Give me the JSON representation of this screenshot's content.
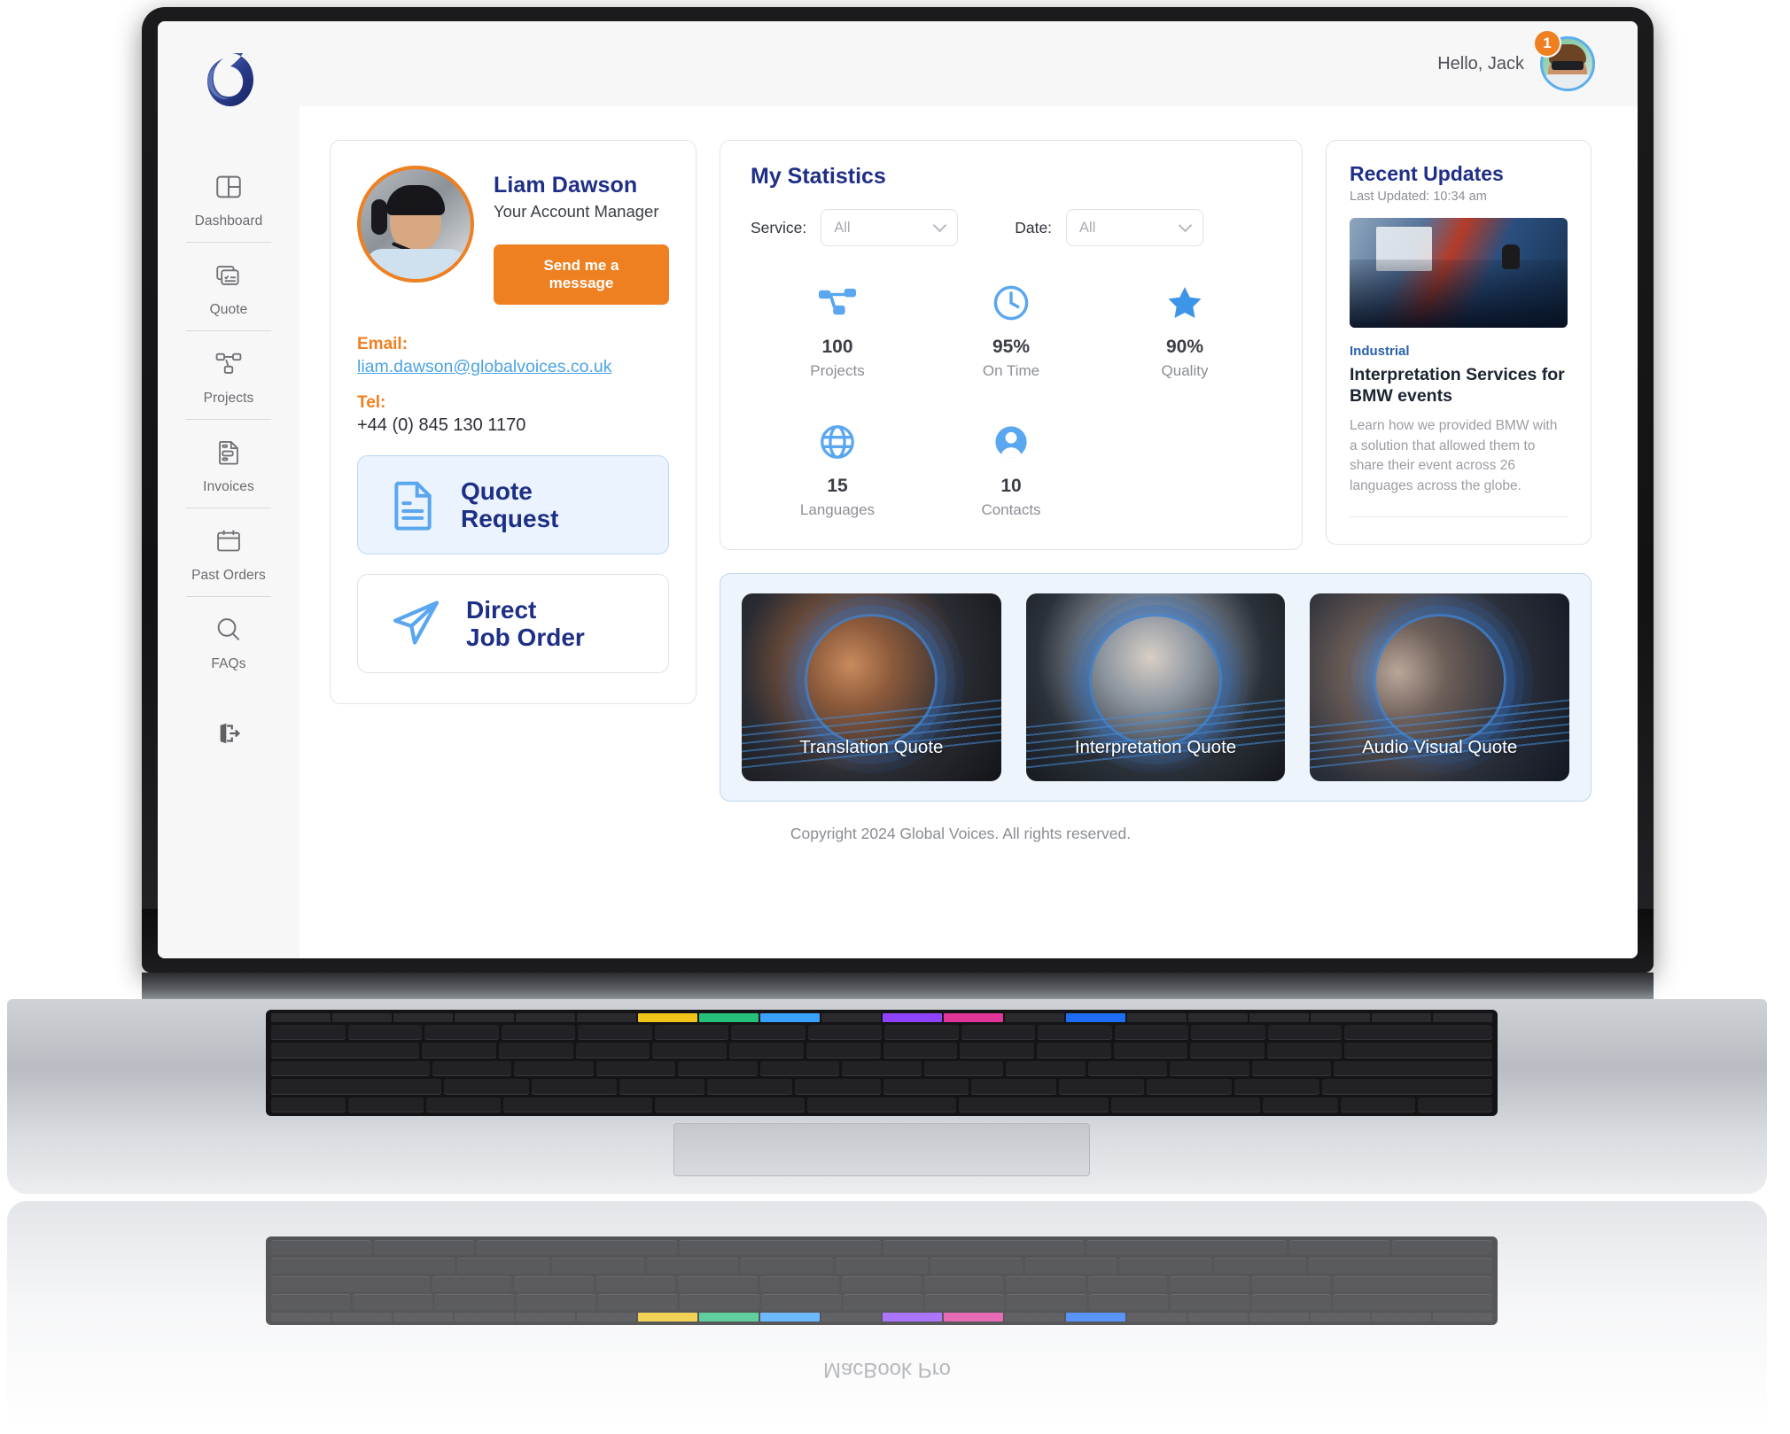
{
  "device": {
    "brand_label": "MacBook Pro"
  },
  "header": {
    "greeting": "Hello, Jack",
    "notification_count": "1"
  },
  "sidebar": {
    "logo_name": "global-voices-logo",
    "items": [
      {
        "label": "Dashboard",
        "icon": "dashboard-icon"
      },
      {
        "label": "Quote",
        "icon": "quote-cards-icon"
      },
      {
        "label": "Projects",
        "icon": "projects-nodes-icon"
      },
      {
        "label": "Invoices",
        "icon": "invoice-document-icon"
      },
      {
        "label": "Past Orders",
        "icon": "calendar-icon"
      },
      {
        "label": "FAQs",
        "icon": "magnifier-icon"
      }
    ],
    "logout_icon": "logout-icon"
  },
  "account_manager": {
    "photo_name": "account-manager-photo",
    "name": "Liam Dawson",
    "role": "Your Account Manager",
    "message_button": "Send me a message",
    "email_label": "Email:",
    "email": "liam.dawson@globalvoices.co.uk",
    "tel_label": "Tel:",
    "tel": "+44 (0) 845 130 1170",
    "actions": [
      {
        "line1": "Quote",
        "line2": "Request",
        "icon": "document-lines-icon"
      },
      {
        "line1": "Direct",
        "line2": "Job Order",
        "icon": "paper-plane-icon"
      }
    ]
  },
  "statistics": {
    "title": "My Statistics",
    "filters": [
      {
        "label": "Service:",
        "value": "All"
      },
      {
        "label": "Date:",
        "value": "All"
      }
    ],
    "items": [
      {
        "value": "100",
        "caption": "Projects",
        "icon": "nodes-icon"
      },
      {
        "value": "95%",
        "caption": "On Time",
        "icon": "clock-icon"
      },
      {
        "value": "90%",
        "caption": "Quality",
        "icon": "star-icon"
      },
      {
        "value": "15",
        "caption": "Languages",
        "icon": "globe-icon"
      },
      {
        "value": "10",
        "caption": "Contacts",
        "icon": "user-icon"
      }
    ]
  },
  "recent_updates": {
    "title": "Recent Updates",
    "last_updated": "Last Updated: 10:34 am",
    "image_name": "conference-crowd-image",
    "tag": "Industrial",
    "headline": "Interpretation Services for BMW events",
    "body": "Learn how we provided BMW with a solution that allowed them to share their event across 26 languages across the globe."
  },
  "quote_cards": [
    {
      "label": "Translation Quote",
      "image_name": "smiling-man-image"
    },
    {
      "label": "Interpretation Quote",
      "image_name": "smiling-woman-image"
    },
    {
      "label": "Audio Visual Quote",
      "image_name": "microphone-image"
    }
  ],
  "footer": {
    "copyright": "Copyright 2024 Global Voices. All rights reserved."
  },
  "colors": {
    "brand_navy": "#1f2f87",
    "accent_orange": "#ef8022",
    "accent_blue": "#5aaef0",
    "link_blue": "#4ba3e3",
    "sidebar_bg": "#f7f7f8"
  }
}
